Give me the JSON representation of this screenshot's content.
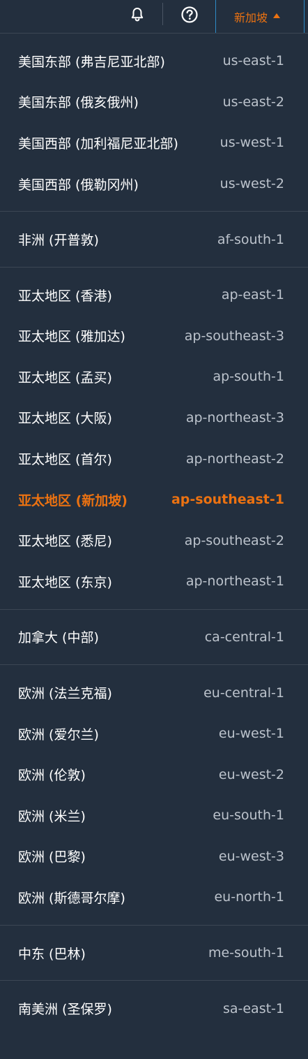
{
  "header": {
    "current_region": "新加坡",
    "icons": {
      "notifications": "bell-icon",
      "help": "help-icon",
      "dropdown": "caret-up-icon"
    }
  },
  "colors": {
    "background": "#232f3e",
    "active": "#ec7211",
    "region_name": "#ffffff",
    "region_code": "#bcc3cc",
    "divider": "#3c4654"
  },
  "groups": [
    {
      "items": [
        {
          "name": "美国东部 (弗吉尼亚北部)",
          "code": "us-east-1"
        },
        {
          "name": "美国东部 (俄亥俄州)",
          "code": "us-east-2"
        },
        {
          "name": "美国西部 (加利福尼亚北部)",
          "code": "us-west-1"
        },
        {
          "name": "美国西部 (俄勒冈州)",
          "code": "us-west-2"
        }
      ]
    },
    {
      "items": [
        {
          "name": "非洲 (开普敦)",
          "code": "af-south-1"
        }
      ]
    },
    {
      "items": [
        {
          "name": "亚太地区 (香港)",
          "code": "ap-east-1"
        },
        {
          "name": "亚太地区 (雅加达)",
          "code": "ap-southeast-3"
        },
        {
          "name": "亚太地区 (孟买)",
          "code": "ap-south-1"
        },
        {
          "name": "亚太地区 (大阪)",
          "code": "ap-northeast-3"
        },
        {
          "name": "亚太地区 (首尔)",
          "code": "ap-northeast-2"
        },
        {
          "name": "亚太地区 (新加坡)",
          "code": "ap-southeast-1",
          "active": true
        },
        {
          "name": "亚太地区 (悉尼)",
          "code": "ap-southeast-2"
        },
        {
          "name": "亚太地区 (东京)",
          "code": "ap-northeast-1"
        }
      ]
    },
    {
      "items": [
        {
          "name": "加拿大 (中部)",
          "code": "ca-central-1"
        }
      ]
    },
    {
      "items": [
        {
          "name": "欧洲 (法兰克福)",
          "code": "eu-central-1"
        },
        {
          "name": "欧洲 (爱尔兰)",
          "code": "eu-west-1"
        },
        {
          "name": "欧洲 (伦敦)",
          "code": "eu-west-2"
        },
        {
          "name": "欧洲 (米兰)",
          "code": "eu-south-1"
        },
        {
          "name": "欧洲 (巴黎)",
          "code": "eu-west-3"
        },
        {
          "name": "欧洲 (斯德哥尔摩)",
          "code": "eu-north-1"
        }
      ]
    },
    {
      "items": [
        {
          "name": "中东 (巴林)",
          "code": "me-south-1"
        }
      ]
    },
    {
      "items": [
        {
          "name": "南美洲 (圣保罗)",
          "code": "sa-east-1"
        }
      ]
    }
  ]
}
